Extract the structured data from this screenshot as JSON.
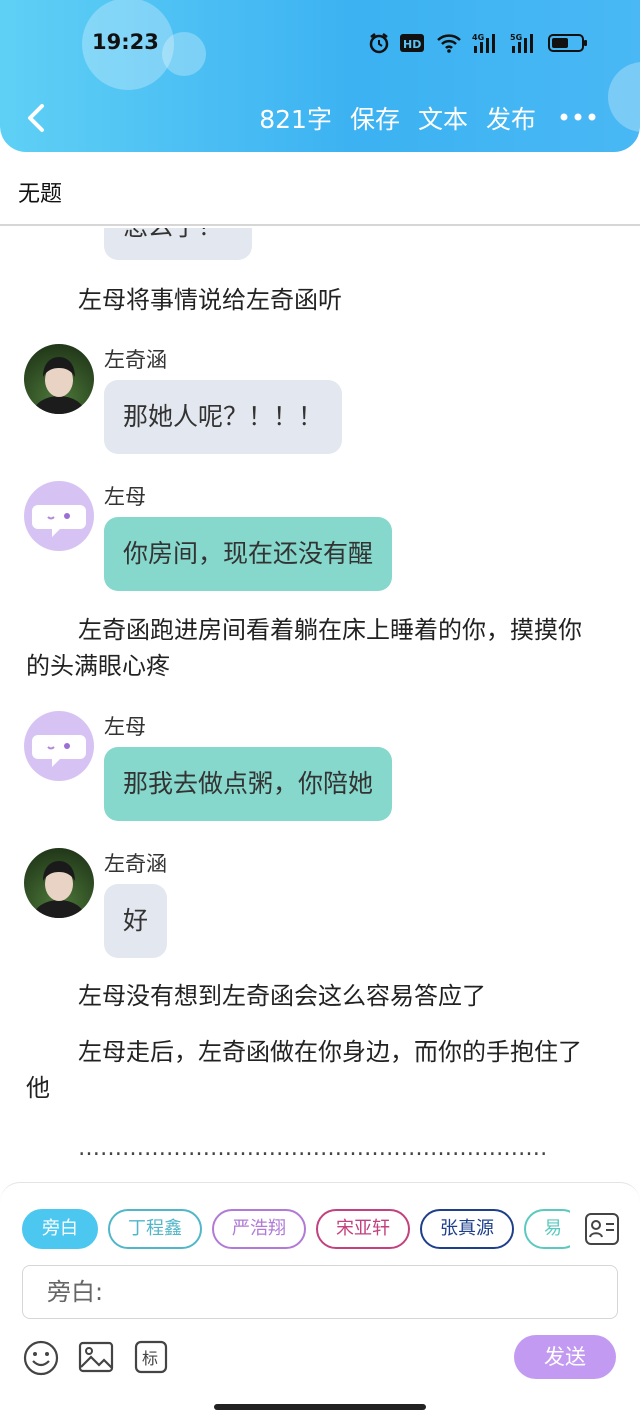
{
  "status_bar": {
    "time": "19:23",
    "icons": [
      "alarm-icon",
      "hd-icon",
      "wifi-icon",
      "signal-4g-icon",
      "signal-5g-icon",
      "battery-icon"
    ],
    "hd_label": "HD",
    "net1": "4G",
    "net2": "5G"
  },
  "nav": {
    "word_count": "821字",
    "save": "保存",
    "text": "文本",
    "publish": "发布"
  },
  "doc": {
    "title": "无题"
  },
  "story": {
    "partial_bubble": "怎么了？",
    "narration_1": "左母将事情说给左奇函听",
    "msg_1": {
      "name": "左奇涵",
      "text": "那她人呢？！！！"
    },
    "msg_2": {
      "name": "左母",
      "text": "你房间，现在还没有醒"
    },
    "narration_2": "左奇函跑进房间看着躺在床上睡着的你，摸摸你的头满眼心疼",
    "msg_3": {
      "name": "左母",
      "text": "那我去做点粥，你陪她"
    },
    "msg_4": {
      "name": "左奇涵",
      "text": "好"
    },
    "narration_3": "左母没有想到左奇函会这么容易答应了",
    "narration_4": "左母走后，左奇函做在你身边，而你的手抱住了他",
    "ellipsis": "…………………………………………………………………………"
  },
  "composer": {
    "chips": [
      {
        "label": "旁白",
        "color": "#4cc7f0"
      },
      {
        "label": "丁程鑫",
        "color": "#52b6c9"
      },
      {
        "label": "严浩翔",
        "color": "#b07ad6"
      },
      {
        "label": "宋亚轩",
        "color": "#c2417e"
      },
      {
        "label": "张真源",
        "color": "#1e3f8a"
      },
      {
        "label": "易",
        "color": "#5bc9bf"
      }
    ],
    "input_label": "旁白:",
    "tag_button": "标",
    "send": "发送"
  }
}
